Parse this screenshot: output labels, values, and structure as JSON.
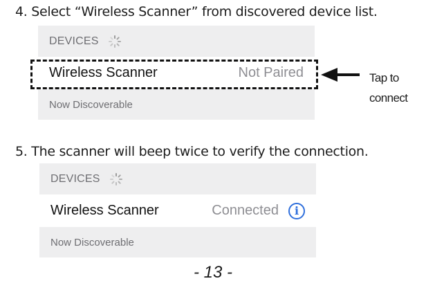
{
  "instructions": {
    "step4": "4. Select “Wireless Scanner” from discovered device list.",
    "step5": "5. The scanner will beep twice to verify the connection."
  },
  "panel_step4": {
    "header": "DEVICES",
    "device_name": "Wireless Scanner",
    "status": "Not Paired",
    "footer": "Now Discoverable"
  },
  "panel_step5": {
    "header": "DEVICES",
    "device_name": "Wireless Scanner",
    "status": "Connected",
    "footer": "Now Discoverable",
    "info_icon_glyph": "i"
  },
  "callout": {
    "line1": "Tap to",
    "line2": "connect"
  },
  "page_number": "- 13 -",
  "colors": {
    "section_background": "#eeeeef",
    "status_gray": "#8e8e93",
    "info_blue": "#2f6fdc"
  },
  "icons": {
    "spinner": "activity-spinner-icon",
    "info": "info-circle-icon",
    "arrow": "left-arrow-icon"
  }
}
